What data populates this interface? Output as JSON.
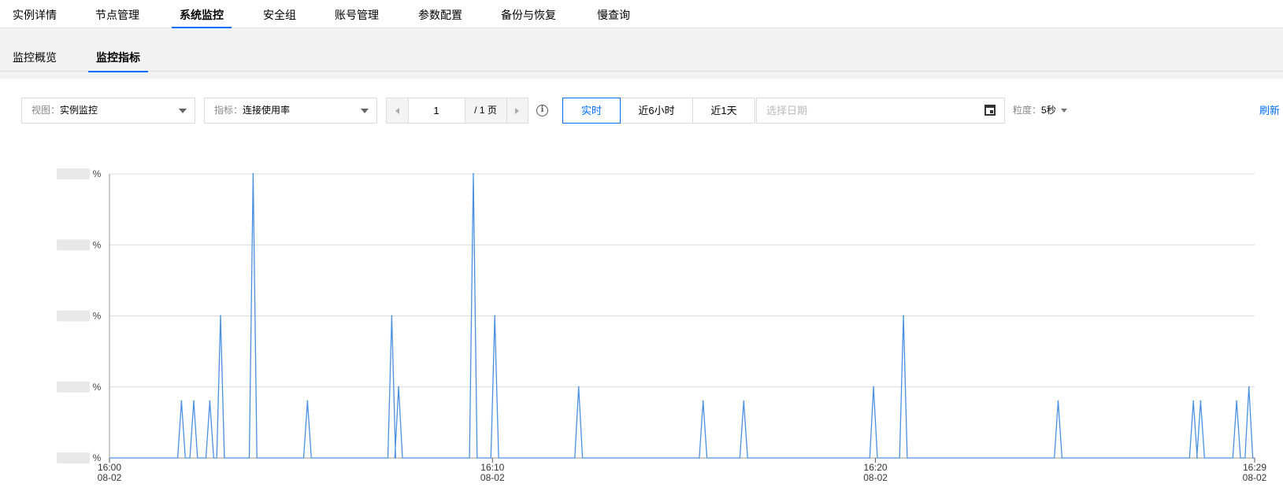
{
  "topnav": {
    "tabs": [
      {
        "label": "实例详情",
        "active": false
      },
      {
        "label": "节点管理",
        "active": false
      },
      {
        "label": "系统监控",
        "active": true
      },
      {
        "label": "安全组",
        "active": false
      },
      {
        "label": "账号管理",
        "active": false
      },
      {
        "label": "参数配置",
        "active": false
      },
      {
        "label": "备份与恢复",
        "active": false
      },
      {
        "label": "慢查询",
        "active": false
      }
    ]
  },
  "subnav": {
    "tabs": [
      {
        "label": "监控概览",
        "active": false
      },
      {
        "label": "监控指标",
        "active": true
      }
    ]
  },
  "toolbar": {
    "view_label": "视图：",
    "view_value": "实例监控",
    "metric_label": "指标：",
    "metric_value": "连接使用率",
    "page_value": "1",
    "page_total": "/ 1 页",
    "info_glyph": "i",
    "time_buttons": [
      {
        "label": "实时",
        "active": true
      },
      {
        "label": "近6小时",
        "active": false
      },
      {
        "label": "近1天",
        "active": false
      }
    ],
    "date_placeholder": "选择日期",
    "granularity_label": "粒度：",
    "granularity_value": "5秒",
    "refresh_label": "刷新"
  },
  "colors": {
    "accent": "#006eff",
    "line": "#4a90e2",
    "grid": "#dcdcdc"
  },
  "chart_data": {
    "type": "line",
    "y_unit": "%",
    "y_tick_unit_labels": [
      "%",
      "%",
      "%",
      "%",
      "%"
    ],
    "y_levels": [
      0,
      1,
      2,
      3,
      4
    ],
    "x_ticks": [
      {
        "time": "16:00",
        "date": "08-02",
        "minutes": 0
      },
      {
        "time": "16:10",
        "date": "08-02",
        "minutes": 10
      },
      {
        "time": "16:20",
        "date": "08-02",
        "minutes": 20
      },
      {
        "time": "16:29",
        "date": "08-02",
        "minutes": 29.9
      }
    ],
    "x_range_minutes": [
      0,
      29.9
    ],
    "ylim": [
      0,
      4
    ],
    "series": [
      {
        "baseline": 0,
        "spikes": [
          {
            "t": 1.88,
            "v": 0.8
          },
          {
            "t": 2.2,
            "v": 0.8
          },
          {
            "t": 2.62,
            "v": 0.8
          },
          {
            "t": 2.9,
            "v": 2
          },
          {
            "t": 3.75,
            "v": 4
          },
          {
            "t": 5.17,
            "v": 0.8
          },
          {
            "t": 7.37,
            "v": 2
          },
          {
            "t": 7.55,
            "v": 1
          },
          {
            "t": 9.5,
            "v": 4
          },
          {
            "t": 10.06,
            "v": 2
          },
          {
            "t": 12.25,
            "v": 1
          },
          {
            "t": 15.5,
            "v": 0.8
          },
          {
            "t": 16.56,
            "v": 0.8
          },
          {
            "t": 19.95,
            "v": 1
          },
          {
            "t": 20.73,
            "v": 2
          },
          {
            "t": 24.77,
            "v": 0.8
          },
          {
            "t": 28.3,
            "v": 0.8
          },
          {
            "t": 28.49,
            "v": 0.8
          },
          {
            "t": 29.43,
            "v": 0.8
          },
          {
            "t": 29.75,
            "v": 1
          }
        ]
      }
    ],
    "grid": true
  }
}
